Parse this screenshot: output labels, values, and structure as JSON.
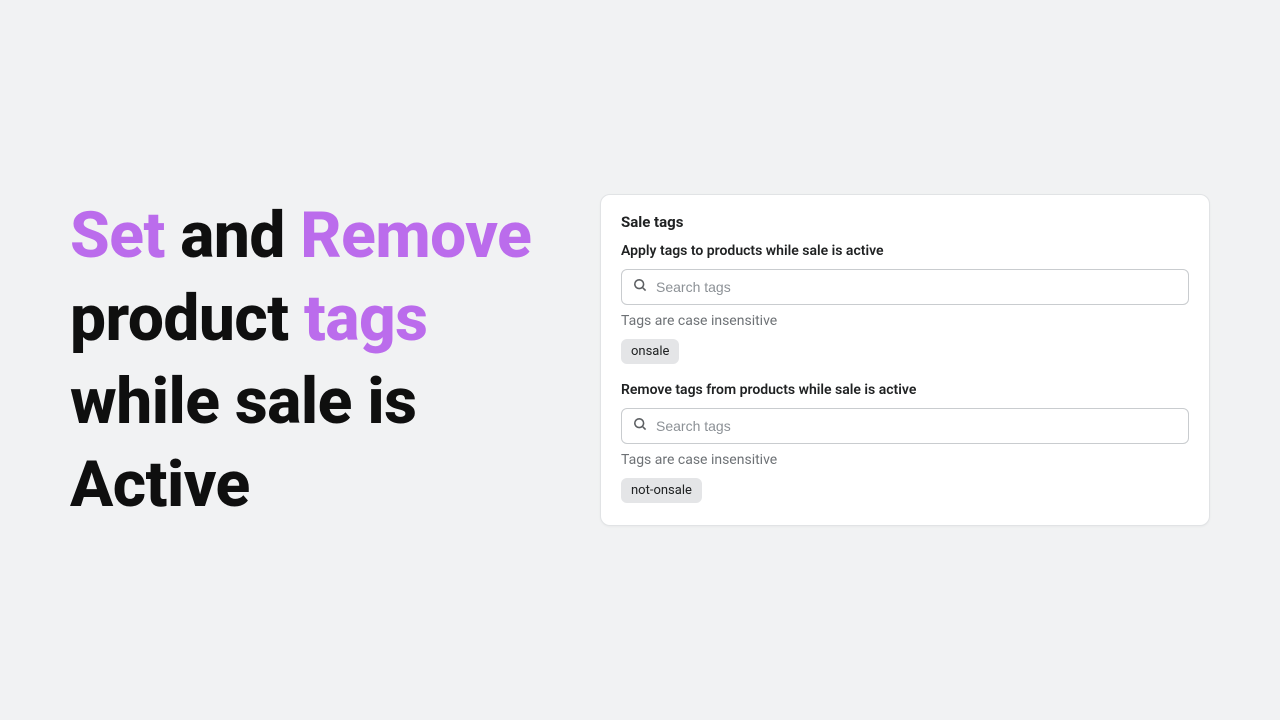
{
  "headline": {
    "word_set": "Set",
    "word_and": " and ",
    "word_remove": "Remove",
    "word_product": " product ",
    "word_tags": "tags",
    "rest": " while sale is Active"
  },
  "card": {
    "title": "Sale tags",
    "apply": {
      "label": "Apply tags to products while sale is active",
      "placeholder": "Search tags",
      "hint": "Tags are case insensitive",
      "tag": "onsale"
    },
    "remove": {
      "label": "Remove tags from products while sale is active",
      "placeholder": "Search tags",
      "hint": "Tags are case insensitive",
      "tag": "not-onsale"
    }
  }
}
